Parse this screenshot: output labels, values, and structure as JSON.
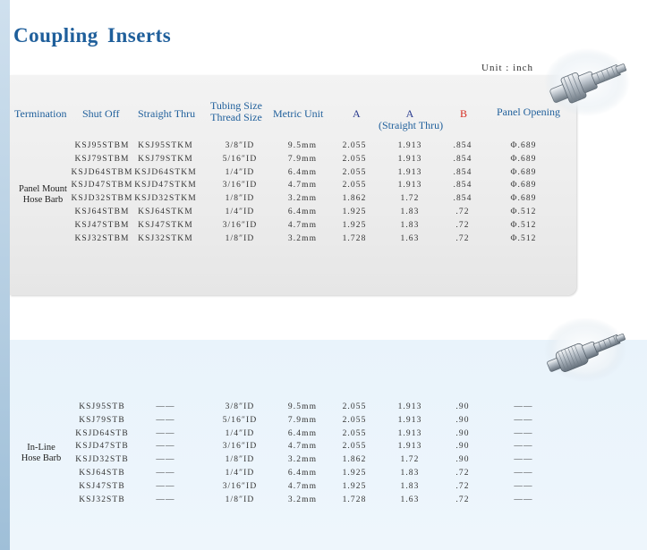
{
  "title": "Coupling  Inserts",
  "unit_label": "Unit : inch",
  "headers": {
    "termination": "Termination",
    "shut_off": "Shut Off",
    "straight_thru": "Straight Thru",
    "tubing_size_l1": "Tubing Size",
    "tubing_size_l2": "Thread Size",
    "metric_unit": "Metric Unit",
    "a": "A",
    "a_straight_l1": "A",
    "a_straight_l2": "(Straight Thru)",
    "b": "B",
    "panel_opening": "Panel Opening"
  },
  "colors": {
    "title": "#1f5f9b",
    "header": "#1f5f9b",
    "b_header": "#d62a1e",
    "panel1_bg": "#ececec",
    "panel2_bg": "#e9f3fb"
  },
  "sections": [
    {
      "label_l1": "Panel Mount",
      "label_l2": "Hose Barb",
      "rows": [
        {
          "shut_off": "KSJ95STBM",
          "straight_thru": "KSJ95STKM",
          "tubing": "3/8″ID",
          "metric": "9.5mm",
          "a": "2.055",
          "a_straight": "1.913",
          "b": ".854",
          "panel": "Φ.689"
        },
        {
          "shut_off": "KSJ79STBM",
          "straight_thru": "KSJ79STKM",
          "tubing": "5/16″ID",
          "metric": "7.9mm",
          "a": "2.055",
          "a_straight": "1.913",
          "b": ".854",
          "panel": "Φ.689"
        },
        {
          "shut_off": "KSJD64STBM",
          "straight_thru": "KSJD64STKM",
          "tubing": "1/4″ID",
          "metric": "6.4mm",
          "a": "2.055",
          "a_straight": "1.913",
          "b": ".854",
          "panel": "Φ.689"
        },
        {
          "shut_off": "KSJD47STBM",
          "straight_thru": "KSJD47STKM",
          "tubing": "3/16″ID",
          "metric": "4.7mm",
          "a": "2.055",
          "a_straight": "1.913",
          "b": ".854",
          "panel": "Φ.689"
        },
        {
          "shut_off": "KSJD32STBM",
          "straight_thru": "KSJD32STKM",
          "tubing": "1/8″ID",
          "metric": "3.2mm",
          "a": "1.862",
          "a_straight": "1.72",
          "b": ".854",
          "panel": "Φ.689"
        },
        {
          "shut_off": "KSJ64STBM",
          "straight_thru": "KSJ64STKM",
          "tubing": "1/4″ID",
          "metric": "6.4mm",
          "a": "1.925",
          "a_straight": "1.83",
          "b": ".72",
          "panel": "Φ.512"
        },
        {
          "shut_off": "KSJ47STBM",
          "straight_thru": "KSJ47STKM",
          "tubing": "3/16″ID",
          "metric": "4.7mm",
          "a": "1.925",
          "a_straight": "1.83",
          "b": ".72",
          "panel": "Φ.512"
        },
        {
          "shut_off": "KSJ32STBM",
          "straight_thru": "KSJ32STKM",
          "tubing": "1/8″ID",
          "metric": "3.2mm",
          "a": "1.728",
          "a_straight": "1.63",
          "b": ".72",
          "panel": "Φ.512"
        }
      ]
    },
    {
      "label_l1": "In-Line",
      "label_l2": "Hose Barb",
      "rows": [
        {
          "shut_off": "KSJ95STB",
          "straight_thru": "——",
          "tubing": "3/8″ID",
          "metric": "9.5mm",
          "a": "2.055",
          "a_straight": "1.913",
          "b": ".90",
          "panel": "——"
        },
        {
          "shut_off": "KSJ79STB",
          "straight_thru": "——",
          "tubing": "5/16″ID",
          "metric": "7.9mm",
          "a": "2.055",
          "a_straight": "1.913",
          "b": ".90",
          "panel": "——"
        },
        {
          "shut_off": "KSJD64STB",
          "straight_thru": "——",
          "tubing": "1/4″ID",
          "metric": "6.4mm",
          "a": "2.055",
          "a_straight": "1.913",
          "b": ".90",
          "panel": "——"
        },
        {
          "shut_off": "KSJD47STB",
          "straight_thru": "——",
          "tubing": "3/16″ID",
          "metric": "4.7mm",
          "a": "2.055",
          "a_straight": "1.913",
          "b": ".90",
          "panel": "——"
        },
        {
          "shut_off": "KSJD32STB",
          "straight_thru": "——",
          "tubing": "1/8″ID",
          "metric": "3.2mm",
          "a": "1.862",
          "a_straight": "1.72",
          "b": ".90",
          "panel": "——"
        },
        {
          "shut_off": "KSJ64STB",
          "straight_thru": "——",
          "tubing": "1/4″ID",
          "metric": "6.4mm",
          "a": "1.925",
          "a_straight": "1.83",
          "b": ".72",
          "panel": "——"
        },
        {
          "shut_off": "KSJ47STB",
          "straight_thru": "——",
          "tubing": "3/16″ID",
          "metric": "4.7mm",
          "a": "1.925",
          "a_straight": "1.83",
          "b": ".72",
          "panel": "——"
        },
        {
          "shut_off": "KSJ32STB",
          "straight_thru": "——",
          "tubing": "1/8″ID",
          "metric": "3.2mm",
          "a": "1.728",
          "a_straight": "1.63",
          "b": ".72",
          "panel": "——"
        }
      ]
    }
  ]
}
